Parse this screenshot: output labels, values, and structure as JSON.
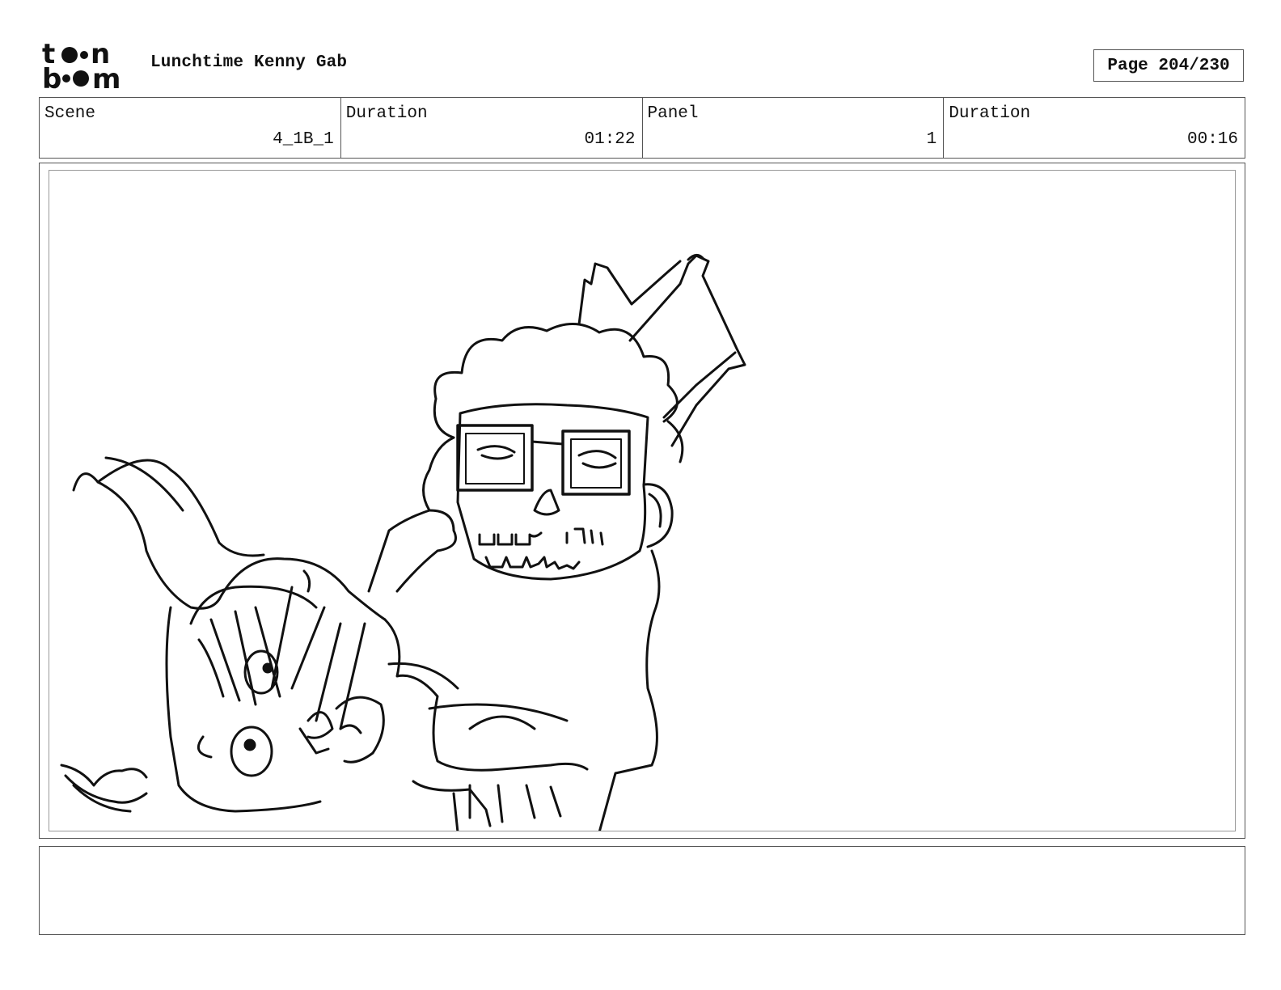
{
  "header": {
    "logo_brand": "toon boom",
    "project_title": "Lunchtime Kenny Gab",
    "page_indicator": "Page 204/230"
  },
  "info": [
    {
      "label": "Scene",
      "value": "4_1B_1"
    },
    {
      "label": "Duration",
      "value": "01:22"
    },
    {
      "label": "Panel",
      "value": "1"
    },
    {
      "label": "Duration",
      "value": "00:16"
    }
  ],
  "panel": {
    "drawing": "storyboard-sketch"
  },
  "notes": {
    "text": ""
  }
}
